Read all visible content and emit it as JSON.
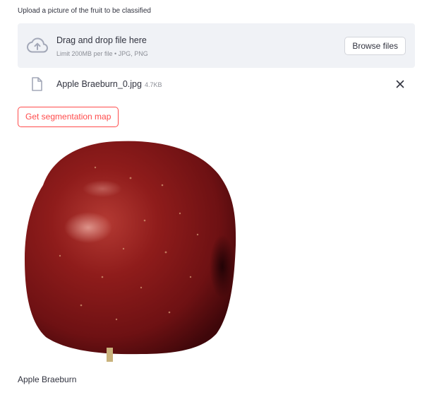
{
  "uploader": {
    "label": "Upload a picture of the fruit to be classified",
    "drop_title": "Drag and drop file here",
    "drop_limit": "Limit 200MB per file • JPG, PNG",
    "browse_label": "Browse files",
    "upload_icon": "cloud-upload-icon"
  },
  "file": {
    "name": "Apple Braeburn_0.jpg",
    "size": "4.7KB",
    "file_icon": "file-icon",
    "remove_icon": "close-icon"
  },
  "actions": {
    "segmentation_label": "Get segmentation map"
  },
  "result": {
    "image_subject": "apple",
    "caption": "Apple Braeburn"
  },
  "colors": {
    "accent": "#ff4b4b",
    "dropzone_bg": "#f0f2f6",
    "text": "#31333f",
    "muted": "#8c8f97"
  }
}
